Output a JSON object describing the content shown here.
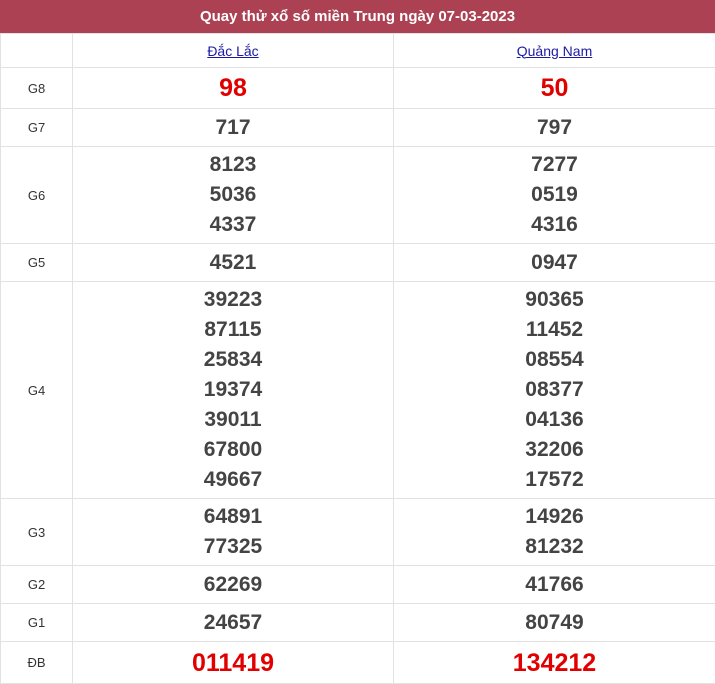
{
  "title": "Quay thử xổ số miền Trung ngày 07-03-2023",
  "provinces": [
    "Đắc Lắc",
    "Quảng Nam"
  ],
  "prizes": {
    "g8": {
      "label": "G8",
      "p1": [
        "98"
      ],
      "p2": [
        "50"
      ]
    },
    "g7": {
      "label": "G7",
      "p1": [
        "717"
      ],
      "p2": [
        "797"
      ]
    },
    "g6": {
      "label": "G6",
      "p1": [
        "8123",
        "5036",
        "4337"
      ],
      "p2": [
        "7277",
        "0519",
        "4316"
      ]
    },
    "g5": {
      "label": "G5",
      "p1": [
        "4521"
      ],
      "p2": [
        "0947"
      ]
    },
    "g4": {
      "label": "G4",
      "p1": [
        "39223",
        "87115",
        "25834",
        "19374",
        "39011",
        "67800",
        "49667"
      ],
      "p2": [
        "90365",
        "11452",
        "08554",
        "08377",
        "04136",
        "32206",
        "17572"
      ]
    },
    "g3": {
      "label": "G3",
      "p1": [
        "64891",
        "77325"
      ],
      "p2": [
        "14926",
        "81232"
      ]
    },
    "g2": {
      "label": "G2",
      "p1": [
        "62269"
      ],
      "p2": [
        "41766"
      ]
    },
    "g1": {
      "label": "G1",
      "p1": [
        "24657"
      ],
      "p2": [
        "80749"
      ]
    },
    "db": {
      "label": "ĐB",
      "p1": [
        "011419"
      ],
      "p2": [
        "134212"
      ]
    }
  },
  "colors": {
    "header_bg": "#ab4152",
    "highlight": "#e00000",
    "link": "#1a1aa6"
  }
}
